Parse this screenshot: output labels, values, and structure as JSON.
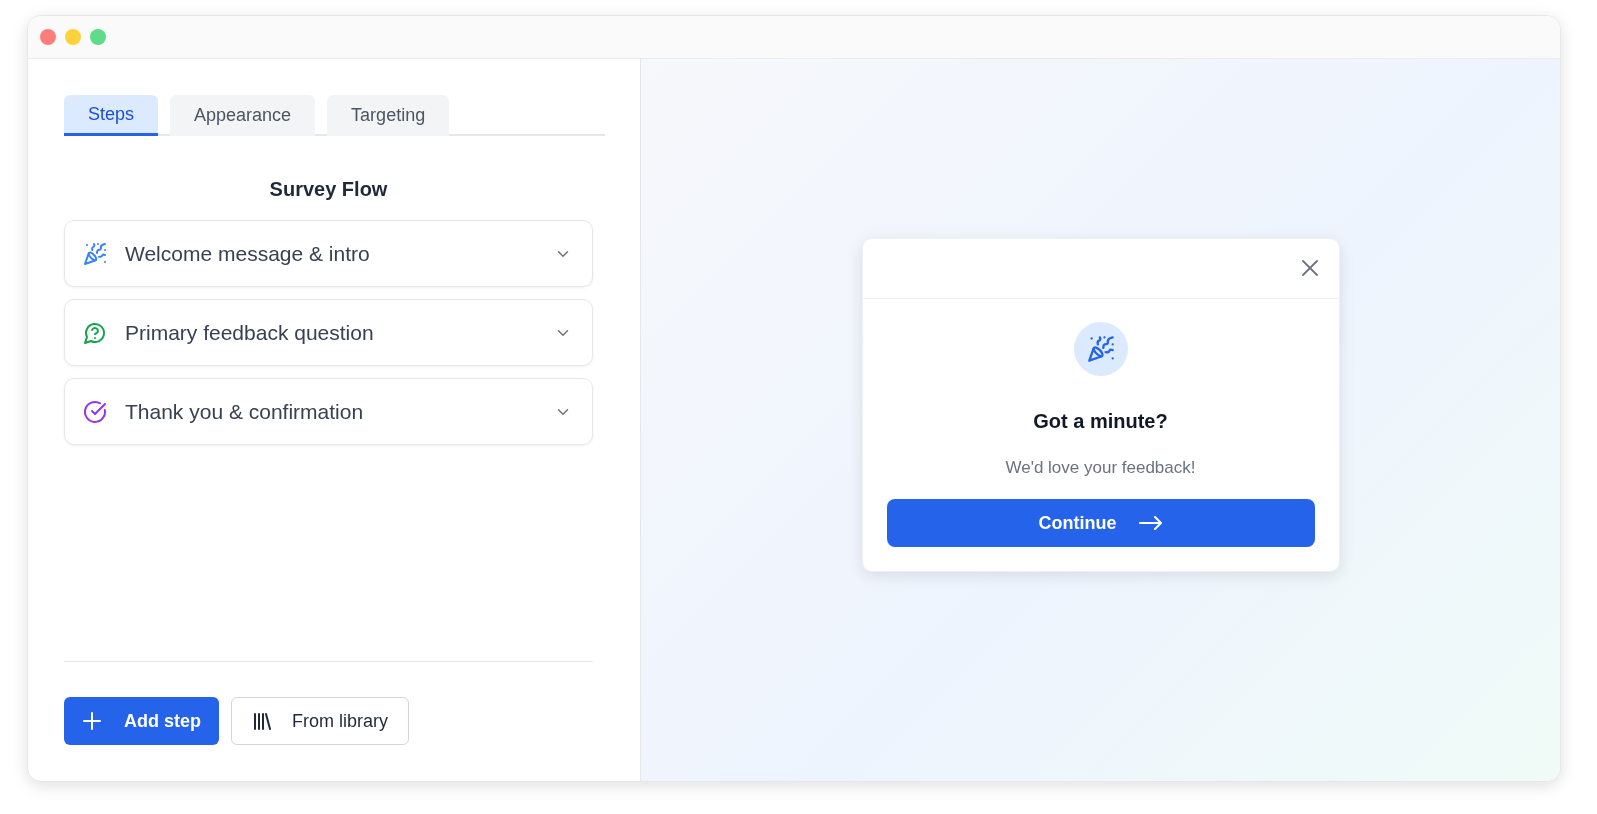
{
  "tabs": [
    {
      "label": "Steps",
      "selected": true
    },
    {
      "label": "Appearance",
      "selected": false
    },
    {
      "label": "Targeting",
      "selected": false
    }
  ],
  "flow_title": "Survey Flow",
  "steps": [
    {
      "kind": "party",
      "label": "Welcome message & intro",
      "color": "#3b82f6",
      "expanded": false
    },
    {
      "kind": "question",
      "label": "Primary feedback question",
      "color": "#16a34a",
      "expanded": false
    },
    {
      "kind": "check",
      "label": "Thank you & confirmation",
      "color": "#9333ea",
      "expanded": false
    }
  ],
  "actions": [
    {
      "kind": "primary",
      "label": "Add step"
    },
    {
      "kind": "secondary",
      "label": "From library"
    }
  ],
  "preview": {
    "title": "Got a minute?",
    "subtitle": "We'd love your feedback!",
    "button": "Continue"
  }
}
